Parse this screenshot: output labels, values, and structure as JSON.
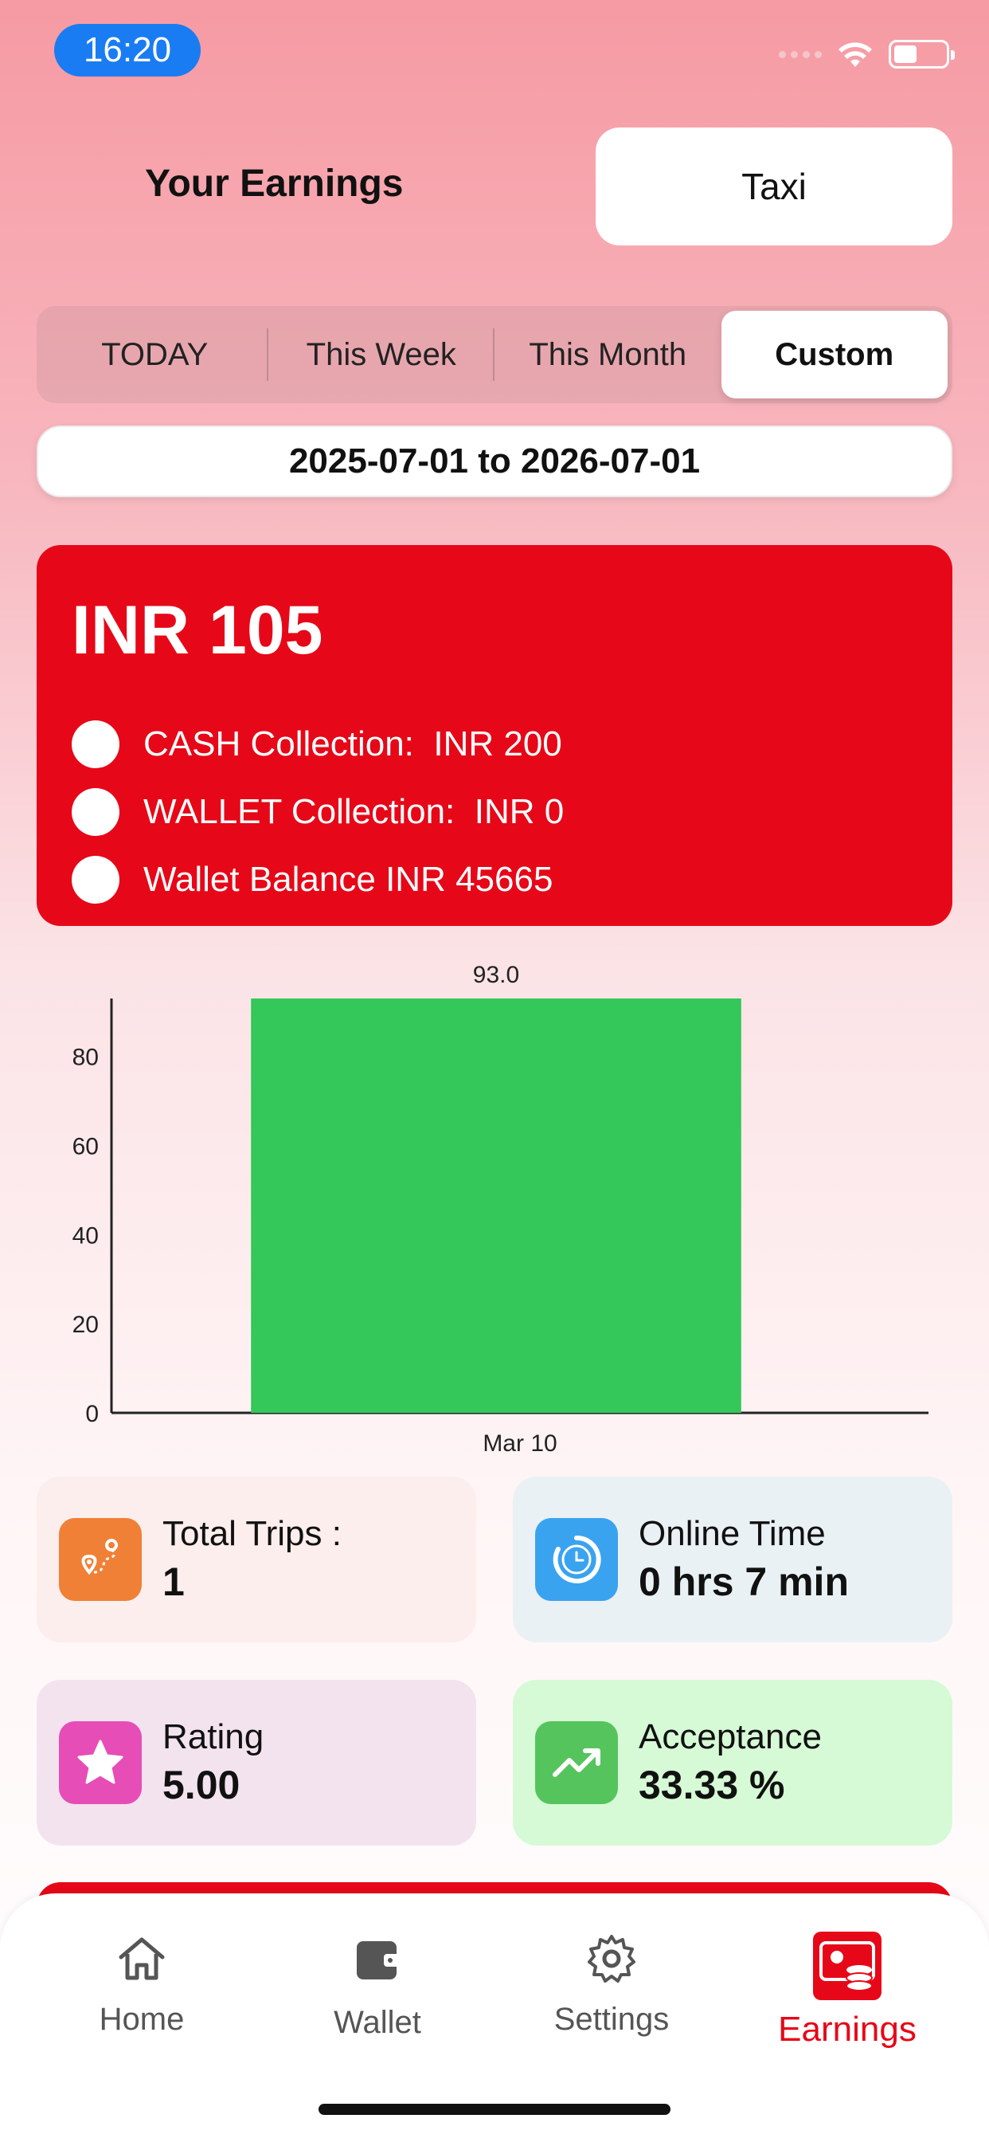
{
  "status_bar": {
    "time": "16:20"
  },
  "header": {
    "title": "Your Earnings",
    "service_button": "Taxi"
  },
  "filters": {
    "tabs": [
      "TODAY",
      "This Week",
      "This Month",
      "Custom"
    ],
    "selected": "Custom",
    "date_range": "2025-07-01 to 2026-07-01"
  },
  "summary": {
    "total": "INR 105",
    "rows": [
      "CASH Collection:  INR 200",
      "WALLET Collection:  INR 0",
      "Wallet Balance INR 45665"
    ]
  },
  "chart_data": {
    "type": "bar",
    "categories": [
      "Mar 10"
    ],
    "values": [
      93.0
    ],
    "data_labels": [
      "93.0"
    ],
    "ylim": [
      0,
      93
    ],
    "yticks": [
      0,
      20,
      40,
      60,
      80
    ],
    "bar_color": "#34c759",
    "grid": false
  },
  "stats": [
    {
      "label": "Total Trips :",
      "value": "1",
      "icon": "route-icon",
      "icon_color": "#f08036"
    },
    {
      "label": "Online Time",
      "value": "0 hrs 7 min",
      "icon": "clock-icon",
      "icon_color": "#3aa3f0"
    },
    {
      "label": "Rating",
      "value": "5.00",
      "icon": "star-icon",
      "icon_color": "#e64db6"
    },
    {
      "label": "Acceptance",
      "value": "33.33 %",
      "icon": "trending-up-icon",
      "icon_color": "#55c45d"
    }
  ],
  "bottom_nav": {
    "items": [
      "Home",
      "Wallet",
      "Settings",
      "Earnings"
    ],
    "active": "Earnings",
    "active_color": "#e60818"
  }
}
